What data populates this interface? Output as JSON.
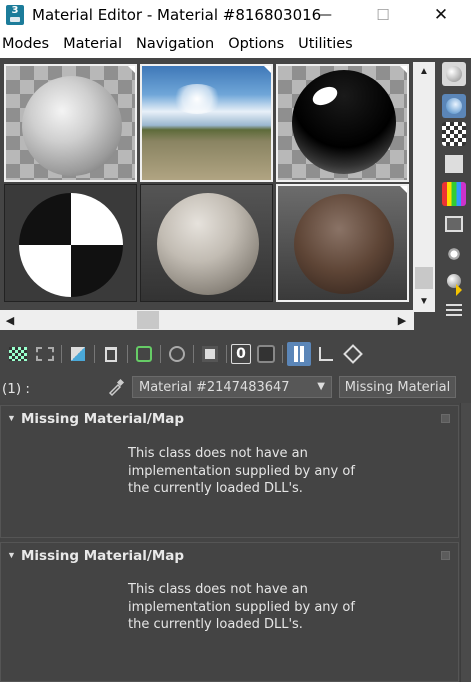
{
  "window": {
    "title": "Material Editor - Material #816803016",
    "minimize_glyph": "—",
    "maximize_glyph": "☐",
    "close_glyph": "✕",
    "app_icon": "3ds-max-icon"
  },
  "menu": {
    "items": [
      "Modes",
      "Material",
      "Navigation",
      "Options",
      "Utilities"
    ]
  },
  "preview": {
    "slots": [
      {
        "name": "concrete-gray",
        "selected": true
      },
      {
        "name": "sky-environment",
        "selected": true
      },
      {
        "name": "black-glossy",
        "selected": true
      },
      {
        "name": "chrome-checker",
        "selected": false
      },
      {
        "name": "stone-checker",
        "selected": false
      },
      {
        "name": "wood-brown",
        "selected": true
      }
    ],
    "vscroll_up": "▲",
    "vscroll_down": "▼",
    "hscroll_left": "◀",
    "hscroll_right": "▶"
  },
  "side_tools": [
    "sample-type-icon",
    "backlight-icon",
    "background-icon",
    "sample-uv-tiling-icon",
    "video-color-check-icon",
    "make-preview-icon",
    "options-icon",
    "select-by-material-icon",
    "material-map-navigator-icon"
  ],
  "toolbar": {
    "buttons": [
      "get-material-icon",
      "put-to-scene-icon",
      "assign-to-selection-icon",
      "reset-map-icon",
      "make-unique-icon",
      "put-to-library-icon",
      "material-id-icon",
      "show-shaded-icon",
      "show-end-result-icon",
      "go-to-parent-icon",
      "go-forward-sibling-icon"
    ],
    "material_id_label": "0"
  },
  "material_row": {
    "slot_label": "(1) :",
    "material_name": "Material #2147483647",
    "material_type": "Missing Material"
  },
  "rollouts": [
    {
      "title": "Missing Material/Map",
      "lines": [
        "This class does not have an",
        "implementation supplied by any of",
        "the currently loaded DLL's."
      ]
    },
    {
      "title": "Missing Material/Map",
      "lines": [
        "This class does not have an",
        "implementation supplied by any of",
        "the currently loaded DLL's."
      ]
    }
  ]
}
